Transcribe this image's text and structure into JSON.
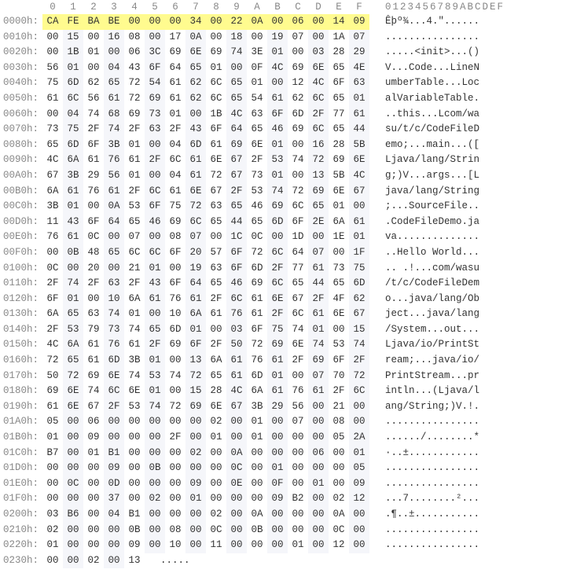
{
  "header": {
    "offsets": [
      "0",
      "1",
      "2",
      "3",
      "4",
      "5",
      "6",
      "7",
      "8",
      "9",
      "A",
      "B",
      "C",
      "D",
      "E",
      "F"
    ],
    "ascii_header": "0123456789ABCDEF"
  },
  "highlight": {
    "row": 0,
    "start": 0,
    "end": 15
  },
  "rows": [
    {
      "offset": "0000h:",
      "bytes": [
        "CA",
        "FE",
        "BA",
        "BE",
        "00",
        "00",
        "00",
        "34",
        "00",
        "22",
        "0A",
        "00",
        "06",
        "00",
        "14",
        "09"
      ],
      "ascii": "Êþº¾...4.\"......"
    },
    {
      "offset": "0010h:",
      "bytes": [
        "00",
        "15",
        "00",
        "16",
        "08",
        "00",
        "17",
        "0A",
        "00",
        "18",
        "00",
        "19",
        "07",
        "00",
        "1A",
        "07"
      ],
      "ascii": "................"
    },
    {
      "offset": "0020h:",
      "bytes": [
        "00",
        "1B",
        "01",
        "00",
        "06",
        "3C",
        "69",
        "6E",
        "69",
        "74",
        "3E",
        "01",
        "00",
        "03",
        "28",
        "29"
      ],
      "ascii": ".....<init>...()"
    },
    {
      "offset": "0030h:",
      "bytes": [
        "56",
        "01",
        "00",
        "04",
        "43",
        "6F",
        "64",
        "65",
        "01",
        "00",
        "0F",
        "4C",
        "69",
        "6E",
        "65",
        "4E"
      ],
      "ascii": "V...Code...LineN"
    },
    {
      "offset": "0040h:",
      "bytes": [
        "75",
        "6D",
        "62",
        "65",
        "72",
        "54",
        "61",
        "62",
        "6C",
        "65",
        "01",
        "00",
        "12",
        "4C",
        "6F",
        "63"
      ],
      "ascii": "umberTable...Loc"
    },
    {
      "offset": "0050h:",
      "bytes": [
        "61",
        "6C",
        "56",
        "61",
        "72",
        "69",
        "61",
        "62",
        "6C",
        "65",
        "54",
        "61",
        "62",
        "6C",
        "65",
        "01"
      ],
      "ascii": "alVariableTable."
    },
    {
      "offset": "0060h:",
      "bytes": [
        "00",
        "04",
        "74",
        "68",
        "69",
        "73",
        "01",
        "00",
        "1B",
        "4C",
        "63",
        "6F",
        "6D",
        "2F",
        "77",
        "61"
      ],
      "ascii": "..this...Lcom/wa"
    },
    {
      "offset": "0070h:",
      "bytes": [
        "73",
        "75",
        "2F",
        "74",
        "2F",
        "63",
        "2F",
        "43",
        "6F",
        "64",
        "65",
        "46",
        "69",
        "6C",
        "65",
        "44"
      ],
      "ascii": "su/t/c/CodeFileD"
    },
    {
      "offset": "0080h:",
      "bytes": [
        "65",
        "6D",
        "6F",
        "3B",
        "01",
        "00",
        "04",
        "6D",
        "61",
        "69",
        "6E",
        "01",
        "00",
        "16",
        "28",
        "5B"
      ],
      "ascii": "emo;...main...(["
    },
    {
      "offset": "0090h:",
      "bytes": [
        "4C",
        "6A",
        "61",
        "76",
        "61",
        "2F",
        "6C",
        "61",
        "6E",
        "67",
        "2F",
        "53",
        "74",
        "72",
        "69",
        "6E"
      ],
      "ascii": "Ljava/lang/Strin"
    },
    {
      "offset": "00A0h:",
      "bytes": [
        "67",
        "3B",
        "29",
        "56",
        "01",
        "00",
        "04",
        "61",
        "72",
        "67",
        "73",
        "01",
        "00",
        "13",
        "5B",
        "4C"
      ],
      "ascii": "g;)V...args...[L"
    },
    {
      "offset": "00B0h:",
      "bytes": [
        "6A",
        "61",
        "76",
        "61",
        "2F",
        "6C",
        "61",
        "6E",
        "67",
        "2F",
        "53",
        "74",
        "72",
        "69",
        "6E",
        "67"
      ],
      "ascii": "java/lang/String"
    },
    {
      "offset": "00C0h:",
      "bytes": [
        "3B",
        "01",
        "00",
        "0A",
        "53",
        "6F",
        "75",
        "72",
        "63",
        "65",
        "46",
        "69",
        "6C",
        "65",
        "01",
        "00"
      ],
      "ascii": ";...SourceFile.."
    },
    {
      "offset": "00D0h:",
      "bytes": [
        "11",
        "43",
        "6F",
        "64",
        "65",
        "46",
        "69",
        "6C",
        "65",
        "44",
        "65",
        "6D",
        "6F",
        "2E",
        "6A",
        "61"
      ],
      "ascii": ".CodeFileDemo.ja"
    },
    {
      "offset": "00E0h:",
      "bytes": [
        "76",
        "61",
        "0C",
        "00",
        "07",
        "00",
        "08",
        "07",
        "00",
        "1C",
        "0C",
        "00",
        "1D",
        "00",
        "1E",
        "01"
      ],
      "ascii": "va.............."
    },
    {
      "offset": "00F0h:",
      "bytes": [
        "00",
        "0B",
        "48",
        "65",
        "6C",
        "6C",
        "6F",
        "20",
        "57",
        "6F",
        "72",
        "6C",
        "64",
        "07",
        "00",
        "1F"
      ],
      "ascii": "..Hello World..."
    },
    {
      "offset": "0100h:",
      "bytes": [
        "0C",
        "00",
        "20",
        "00",
        "21",
        "01",
        "00",
        "19",
        "63",
        "6F",
        "6D",
        "2F",
        "77",
        "61",
        "73",
        "75"
      ],
      "ascii": ".. .!...com/wasu"
    },
    {
      "offset": "0110h:",
      "bytes": [
        "2F",
        "74",
        "2F",
        "63",
        "2F",
        "43",
        "6F",
        "64",
        "65",
        "46",
        "69",
        "6C",
        "65",
        "44",
        "65",
        "6D"
      ],
      "ascii": "/t/c/CodeFileDem"
    },
    {
      "offset": "0120h:",
      "bytes": [
        "6F",
        "01",
        "00",
        "10",
        "6A",
        "61",
        "76",
        "61",
        "2F",
        "6C",
        "61",
        "6E",
        "67",
        "2F",
        "4F",
        "62"
      ],
      "ascii": "o...java/lang/Ob"
    },
    {
      "offset": "0130h:",
      "bytes": [
        "6A",
        "65",
        "63",
        "74",
        "01",
        "00",
        "10",
        "6A",
        "61",
        "76",
        "61",
        "2F",
        "6C",
        "61",
        "6E",
        "67"
      ],
      "ascii": "ject...java/lang"
    },
    {
      "offset": "0140h:",
      "bytes": [
        "2F",
        "53",
        "79",
        "73",
        "74",
        "65",
        "6D",
        "01",
        "00",
        "03",
        "6F",
        "75",
        "74",
        "01",
        "00",
        "15"
      ],
      "ascii": "/System...out..."
    },
    {
      "offset": "0150h:",
      "bytes": [
        "4C",
        "6A",
        "61",
        "76",
        "61",
        "2F",
        "69",
        "6F",
        "2F",
        "50",
        "72",
        "69",
        "6E",
        "74",
        "53",
        "74"
      ],
      "ascii": "Ljava/io/PrintSt"
    },
    {
      "offset": "0160h:",
      "bytes": [
        "72",
        "65",
        "61",
        "6D",
        "3B",
        "01",
        "00",
        "13",
        "6A",
        "61",
        "76",
        "61",
        "2F",
        "69",
        "6F",
        "2F"
      ],
      "ascii": "ream;...java/io/"
    },
    {
      "offset": "0170h:",
      "bytes": [
        "50",
        "72",
        "69",
        "6E",
        "74",
        "53",
        "74",
        "72",
        "65",
        "61",
        "6D",
        "01",
        "00",
        "07",
        "70",
        "72"
      ],
      "ascii": "PrintStream...pr"
    },
    {
      "offset": "0180h:",
      "bytes": [
        "69",
        "6E",
        "74",
        "6C",
        "6E",
        "01",
        "00",
        "15",
        "28",
        "4C",
        "6A",
        "61",
        "76",
        "61",
        "2F",
        "6C"
      ],
      "ascii": "intln...(Ljava/l"
    },
    {
      "offset": "0190h:",
      "bytes": [
        "61",
        "6E",
        "67",
        "2F",
        "53",
        "74",
        "72",
        "69",
        "6E",
        "67",
        "3B",
        "29",
        "56",
        "00",
        "21",
        "00"
      ],
      "ascii": "ang/String;)V.!."
    },
    {
      "offset": "01A0h:",
      "bytes": [
        "05",
        "00",
        "06",
        "00",
        "00",
        "00",
        "00",
        "00",
        "02",
        "00",
        "01",
        "00",
        "07",
        "00",
        "08",
        "00"
      ],
      "ascii": "................"
    },
    {
      "offset": "01B0h:",
      "bytes": [
        "01",
        "00",
        "09",
        "00",
        "00",
        "00",
        "2F",
        "00",
        "01",
        "00",
        "01",
        "00",
        "00",
        "00",
        "05",
        "2A"
      ],
      "ascii": "....../........*"
    },
    {
      "offset": "01C0h:",
      "bytes": [
        "B7",
        "00",
        "01",
        "B1",
        "00",
        "00",
        "00",
        "02",
        "00",
        "0A",
        "00",
        "00",
        "00",
        "06",
        "00",
        "01"
      ],
      "ascii": "·..±............"
    },
    {
      "offset": "01D0h:",
      "bytes": [
        "00",
        "00",
        "00",
        "09",
        "00",
        "0B",
        "00",
        "00",
        "00",
        "0C",
        "00",
        "01",
        "00",
        "00",
        "00",
        "05"
      ],
      "ascii": "................"
    },
    {
      "offset": "01E0h:",
      "bytes": [
        "00",
        "0C",
        "00",
        "0D",
        "00",
        "00",
        "00",
        "09",
        "00",
        "0E",
        "00",
        "0F",
        "00",
        "01",
        "00",
        "09"
      ],
      "ascii": "................"
    },
    {
      "offset": "01F0h:",
      "bytes": [
        "00",
        "00",
        "00",
        "37",
        "00",
        "02",
        "00",
        "01",
        "00",
        "00",
        "00",
        "09",
        "B2",
        "00",
        "02",
        "12"
      ],
      "ascii": "...7........²..."
    },
    {
      "offset": "0200h:",
      "bytes": [
        "03",
        "B6",
        "00",
        "04",
        "B1",
        "00",
        "00",
        "00",
        "02",
        "00",
        "0A",
        "00",
        "00",
        "00",
        "0A",
        "00"
      ],
      "ascii": ".¶..±..........."
    },
    {
      "offset": "0210h:",
      "bytes": [
        "02",
        "00",
        "00",
        "00",
        "0B",
        "00",
        "08",
        "00",
        "0C",
        "00",
        "0B",
        "00",
        "00",
        "00",
        "0C",
        "00"
      ],
      "ascii": "................"
    },
    {
      "offset": "0220h:",
      "bytes": [
        "01",
        "00",
        "00",
        "00",
        "09",
        "00",
        "10",
        "00",
        "11",
        "00",
        "00",
        "00",
        "01",
        "00",
        "12",
        "00"
      ],
      "ascii": "................"
    },
    {
      "offset": "0230h:",
      "bytes": [
        "00",
        "00",
        "02",
        "00",
        "13"
      ],
      "ascii": "....."
    }
  ]
}
